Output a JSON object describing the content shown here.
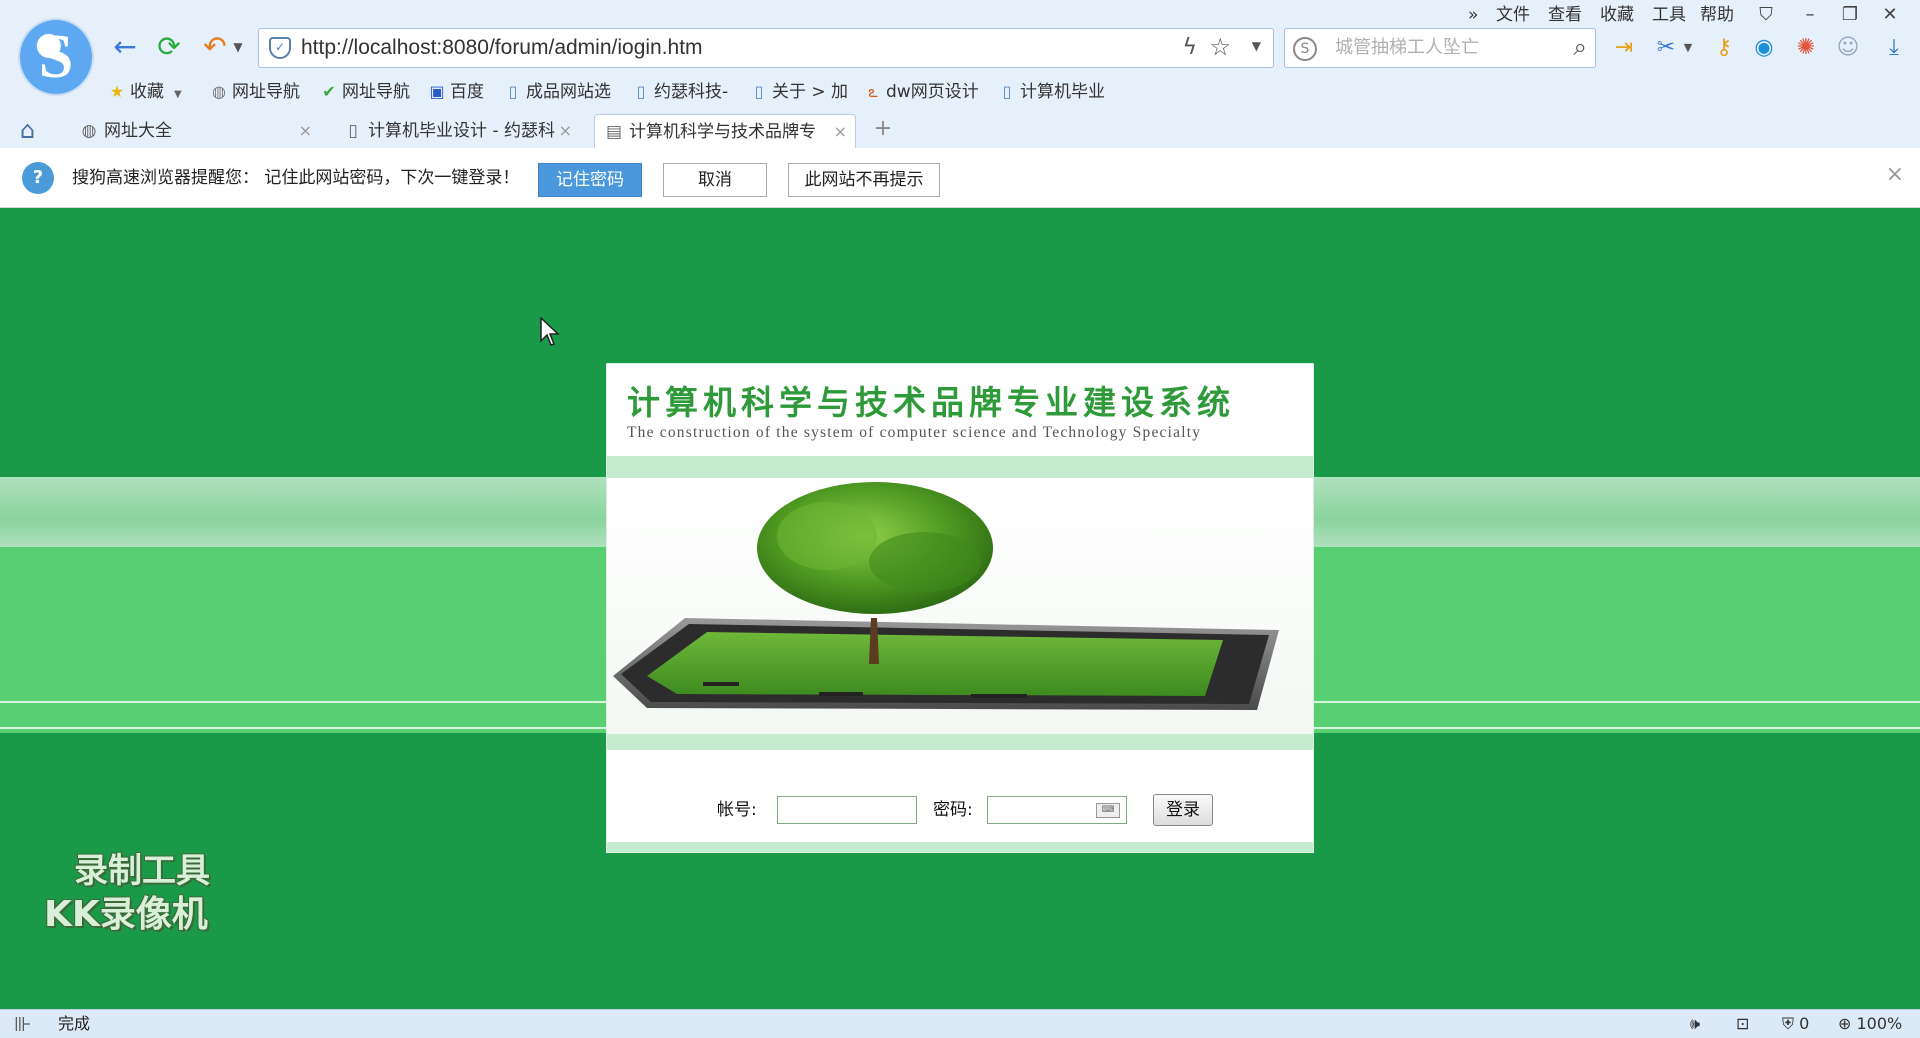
{
  "browser": {
    "url": "http://localhost:8080/forum/admin/iogin.htm",
    "search_placeholder": "城管抽梯工人坠亡",
    "menu": [
      "文件",
      "查看",
      "收藏",
      "工具",
      "帮助"
    ],
    "menu_more": "»",
    "bookmarks": [
      {
        "label": "收藏",
        "icon": "star-icon"
      },
      {
        "label": "网址导航",
        "icon": "globe-icon"
      },
      {
        "label": "网址导航",
        "icon": "check-icon"
      },
      {
        "label": "百度",
        "icon": "paw-icon"
      },
      {
        "label": "成品网站选",
        "icon": "page-icon"
      },
      {
        "label": "约瑟科技-",
        "icon": "page-icon"
      },
      {
        "label": "关于 > 加",
        "icon": "page-icon"
      },
      {
        "label": "dw网页设计",
        "icon": "swirl-icon"
      },
      {
        "label": "计算机毕业",
        "icon": "page-icon"
      }
    ],
    "tabs": [
      {
        "label": "网址大全",
        "active": false
      },
      {
        "label": "计算机毕业设计 - 约瑟科",
        "active": false
      },
      {
        "label": "计算机科学与技术品牌专",
        "active": true
      }
    ],
    "new_tab": "+"
  },
  "notice": {
    "text": "搜狗高速浏览器提醒您： 记住此网站密码，下次一键登录！",
    "remember": "记住密码",
    "cancel": "取消",
    "never": "此网站不再提示",
    "close": "×"
  },
  "login": {
    "title": "计算机科学与技术品牌专业建设系统",
    "subtitle": "The construction of the system of computer science and Technology Specialty",
    "account_label": "帐号:",
    "password_label": "密码:",
    "account_value": "",
    "password_value": "",
    "login_button": "登录"
  },
  "watermark": {
    "line1": "录制工具",
    "line2": "KK录像机"
  },
  "status": {
    "text": "完成",
    "count": "0",
    "zoom": "100%"
  },
  "colors": {
    "page_bg": "#1a9a48",
    "band": "#57cf72",
    "title_green": "#2e9a3a",
    "remember_btn": "#4a97dc"
  }
}
